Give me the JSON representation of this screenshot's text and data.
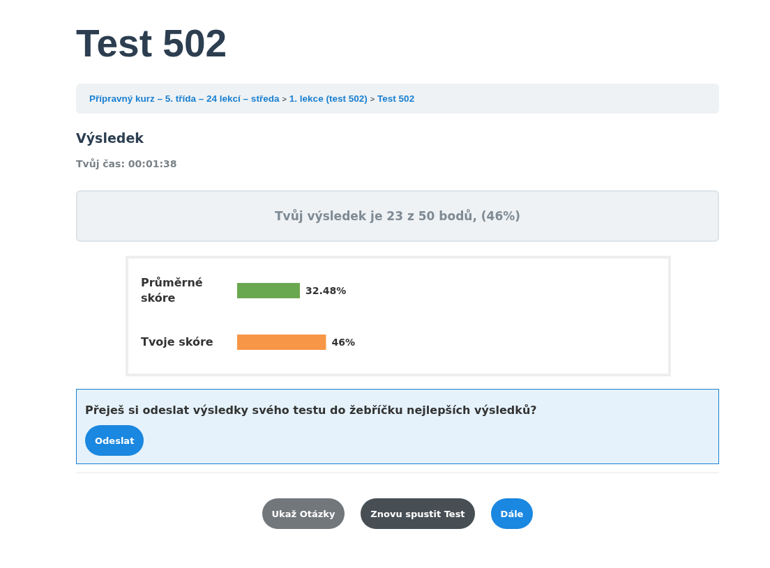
{
  "title": "Test 502",
  "breadcrumb": [
    {
      "label": "Přípravný kurz – 5. třída – 24 lekcí – středa",
      "separator": ">"
    },
    {
      "label": "1. lekce (test 502)",
      "separator": ">"
    },
    {
      "label": "Test 502"
    }
  ],
  "result_heading": "Výsledek",
  "time": "Tvůj čas: 00:01:38",
  "score_banner": "Tvůj výsledek je 23 z 50 bodů, (46%)",
  "score_chart": {
    "chart_data": {
      "type": "bar",
      "orientation": "horizontal",
      "categories": [
        "Průměrné skóre",
        "Tvoje skóre"
      ],
      "series": [
        {
          "color": "#6aa84f",
          "values": [
            32.48,
            null
          ],
          "value_labels": [
            "32.48%",
            null
          ]
        },
        {
          "color": "#f79646",
          "values": [
            null,
            46
          ],
          "value_labels": [
            null,
            "46%"
          ]
        }
      ]
    }
  },
  "leaderboard_prompt": {
    "question": "Přeješ si odeslat výsledky svého testu do žebříčku nejlepších výsledků?",
    "button": "Odeslat"
  },
  "buttons": [
    {
      "label": "Ukaž Otázky",
      "kind": "secondary"
    },
    {
      "label": "Znovu spustit Test",
      "kind": "dark"
    },
    {
      "label": "Dále",
      "kind": "primary"
    }
  ]
}
